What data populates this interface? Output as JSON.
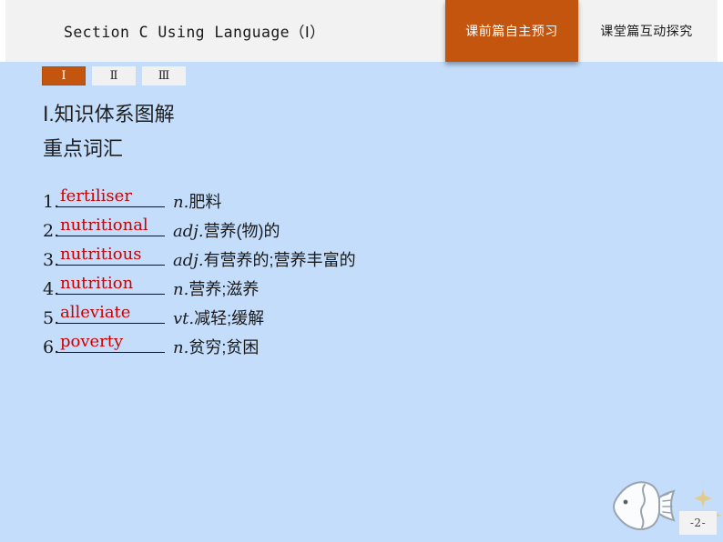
{
  "slide": {
    "page_number": "-2-",
    "background_color": "#c3ddfb",
    "accent_color": "#c4550f",
    "word_color": "#cc0000"
  },
  "header": {
    "title": "Section C  Using Language（Ⅰ）",
    "tabs": [
      {
        "label": "课前篇自主预习",
        "active": true
      },
      {
        "label": "课堂篇互动探究",
        "active": false
      }
    ]
  },
  "section_tabs": [
    {
      "label": "Ⅰ",
      "active": true
    },
    {
      "label": "Ⅱ",
      "active": false
    },
    {
      "label": "Ⅲ",
      "active": false
    }
  ],
  "content": {
    "heading_main": "Ⅰ.知识体系图解",
    "heading_sub": "重点词汇",
    "vocab": [
      {
        "index": "1.",
        "word": "fertiliser",
        "pos": "n.",
        "meaning": "肥料"
      },
      {
        "index": "2.",
        "word": "nutritional",
        "pos": "adj.",
        "meaning": "营养(物)的"
      },
      {
        "index": "3.",
        "word": "nutritious",
        "pos": "adj.",
        "meaning": "有营养的;营养丰富的"
      },
      {
        "index": "4.",
        "word": "nutrition",
        "pos": "n.",
        "meaning": "营养;滋养"
      },
      {
        "index": "5.",
        "word": "alleviate",
        "pos": "vt.",
        "meaning": "减轻;缓解"
      },
      {
        "index": "6.",
        "word": "poverty",
        "pos": "n.",
        "meaning": "贫穷;贫困"
      }
    ]
  },
  "decorations": {
    "fish": "fish-icon",
    "star": "star-icon"
  }
}
